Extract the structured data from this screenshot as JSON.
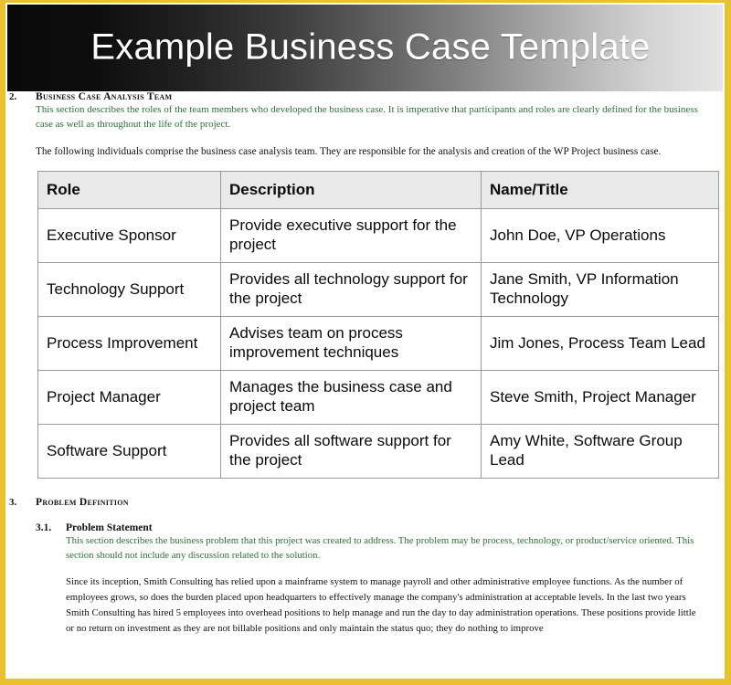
{
  "document": {
    "banner_title": "Example Business Case Template",
    "accent_border_color": "#e8c22c",
    "green_text_color": "#2e7035",
    "table_header_bg": "#e9e9e9"
  },
  "section_team": {
    "number": "2.",
    "title": "Business Case Analysis Team",
    "green_note": "This section describes the roles of the team members who developed the business case.  It is imperative that participants and roles are clearly defined for the business case as well as throughout the life of the project.",
    "intro_paragraph": "The following individuals comprise the business case analysis team.  They are responsible for the analysis and creation of the WP Project business case."
  },
  "team_table": {
    "headers": [
      "Role",
      "Description",
      "Name/Title"
    ],
    "rows": [
      {
        "role": "Executive Sponsor",
        "description": "Provide executive support for the project",
        "name_title": "John Doe, VP Operations"
      },
      {
        "role": "Technology Support",
        "description": "Provides all technology support for the project",
        "name_title": "Jane Smith, VP Information Technology"
      },
      {
        "role": "Process Improvement",
        "description": "Advises team on process improvement techniques",
        "name_title": "Jim Jones, Process Team Lead"
      },
      {
        "role": "Project Manager",
        "description": "Manages the business case and project team",
        "name_title": "Steve Smith, Project Manager"
      },
      {
        "role": "Software Support",
        "description": "Provides all software support for the project",
        "name_title": "Amy White, Software Group Lead"
      }
    ]
  },
  "section_problem": {
    "number": "3.",
    "title": "Problem Definition",
    "subsection": {
      "number": "3.1.",
      "title": "Problem Statement",
      "green_note": "This section describes the business problem that this project was created to address.  The problem may be process, technology, or product/service oriented.  This section should not include any discussion related to the solution.",
      "body_paragraph": "Since its inception, Smith Consulting has relied upon a mainframe system to manage payroll and other administrative employee functions.  As the number of employees grows, so does the burden placed upon headquarters to effectively manage the company's administration at acceptable levels.  In the last two years Smith Consulting has hired 5 employees into overhead positions to help manage and run the day to day administration operations.  These positions provide little or no return on investment as they are not billable positions and only maintain the status quo; they do nothing to improve"
    }
  }
}
